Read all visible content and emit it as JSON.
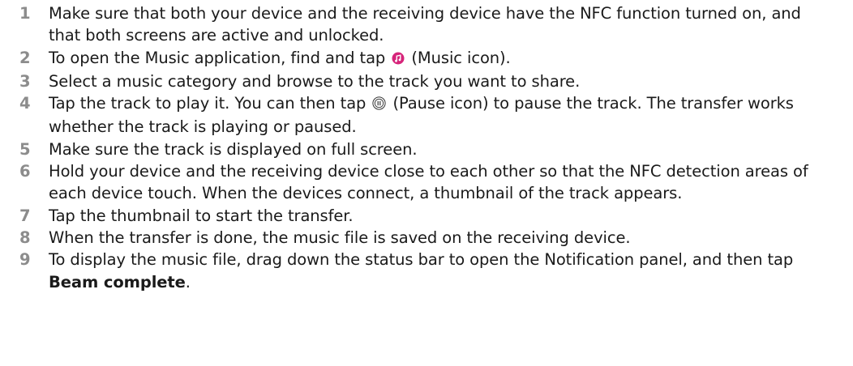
{
  "steps": [
    {
      "number": "1",
      "text": "Make sure that both your device and the receiving device have the NFC function turned on, and that both screens are active and unlocked."
    },
    {
      "number": "2",
      "before": "To open the Music application, find and tap ",
      "after": " (Music icon).",
      "icon": "music-app-icon",
      "icon_color": "#d6247a"
    },
    {
      "number": "3",
      "text": "Select a music category and browse to the track you want to share."
    },
    {
      "number": "4",
      "before": "Tap the track to play it. You can then tap ",
      "after": " (Pause icon) to pause the track. The transfer works whether the track is playing or paused.",
      "icon": "pause-icon"
    },
    {
      "number": "5",
      "text": "Make sure the track is displayed on full screen."
    },
    {
      "number": "6",
      "text": "Hold your device and the receiving device close to each other so that the NFC detection areas of each device touch. When the devices connect, a thumbnail of the track appears."
    },
    {
      "number": "7",
      "text": "Tap the thumbnail to start the transfer."
    },
    {
      "number": "8",
      "text": "When the transfer is done, the music file is saved on the receiving device."
    },
    {
      "number": "9",
      "before": "To display the music file, drag down the status bar to open the Notification panel, and then tap ",
      "bold": "Beam complete",
      "after": "."
    }
  ]
}
